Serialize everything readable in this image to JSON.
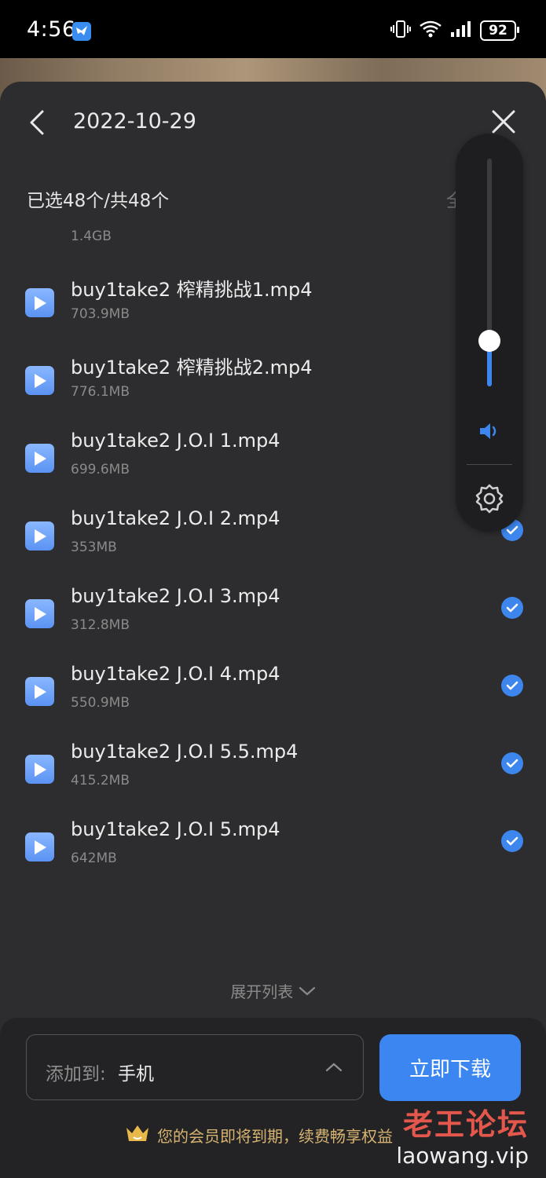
{
  "status_bar": {
    "time": "4:56",
    "battery": "92"
  },
  "header": {
    "title": "2022-10-29"
  },
  "selection": {
    "count_text": "已选48个/共48个",
    "select_all": "全",
    "total_size": "1.4GB"
  },
  "files": [
    {
      "name": "buy1take2 榨精挑战1.mp4",
      "size": "703.9MB",
      "checked": false
    },
    {
      "name": "buy1take2 榨精挑战2.mp4",
      "size": "776.1MB",
      "checked": false
    },
    {
      "name": "buy1take2 J.O.I 1.mp4",
      "size": "699.6MB",
      "checked": false
    },
    {
      "name": "buy1take2 J.O.I 2.mp4",
      "size": "353MB",
      "checked": true
    },
    {
      "name": "buy1take2 J.O.I 3.mp4",
      "size": "312.8MB",
      "checked": true
    },
    {
      "name": "buy1take2 J.O.I 4.mp4",
      "size": "550.9MB",
      "checked": true
    },
    {
      "name": "buy1take2 J.O.I 5.5.mp4",
      "size": "415.2MB",
      "checked": true
    },
    {
      "name": "buy1take2 J.O.I 5.mp4",
      "size": "642MB",
      "checked": true
    }
  ],
  "expand_list": "展开列表",
  "destination": {
    "prefix": "添加到:",
    "value": "手机"
  },
  "download_button": "立即下载",
  "member_notice": "您的会员即将到期，续费畅享权益",
  "watermark": {
    "title": "老王论坛",
    "url": "laowang.vip"
  },
  "volume": {
    "level": 0.2
  },
  "colors": {
    "accent": "#3b86f0",
    "sheet_bg": "#2d2d2f",
    "member_gold": "#d6b370"
  }
}
